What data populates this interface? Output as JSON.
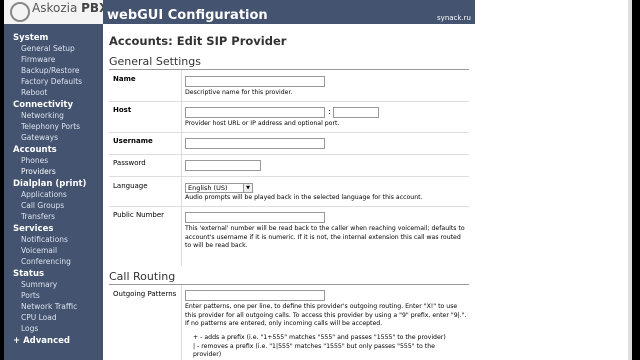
{
  "app": {
    "logo_text": "Askozia",
    "logo_suffix": "PBX",
    "title": "webGUI Configuration",
    "host": "synack.ru"
  },
  "sidebar": {
    "system": {
      "label": "System",
      "items": [
        "General Setup",
        "Firmware",
        "Backup/Restore",
        "Factory Defaults",
        "Reboot"
      ]
    },
    "connectivity": {
      "label": "Connectivity",
      "items": [
        "Networking",
        "Telephony Ports",
        "Gateways"
      ]
    },
    "accounts": {
      "label": "Accounts",
      "items": [
        "Phones",
        "Providers"
      ]
    },
    "dialplan": {
      "label": "Dialplan (print)",
      "items": [
        "Applications",
        "Call Groups",
        "Transfers"
      ]
    },
    "services": {
      "label": "Services",
      "items": [
        "Notifications",
        "Voicemail",
        "Conferencing"
      ]
    },
    "status": {
      "label": "Status",
      "items": [
        "Summary",
        "Ports",
        "Network Traffic",
        "CPU Load",
        "Logs"
      ]
    },
    "advanced": {
      "label": "+ Advanced"
    }
  },
  "page": {
    "title": "Accounts: Edit SIP Provider",
    "general_settings": "General Settings",
    "call_routing": "Call Routing"
  },
  "fields": {
    "name": {
      "label": "Name",
      "value": "",
      "help": "Descriptive name for this provider."
    },
    "host": {
      "label": "Host",
      "value": "",
      "port": "",
      "colon": ":",
      "help": "Provider host URL or IP address and optional port."
    },
    "username": {
      "label": "Username",
      "value": ""
    },
    "password": {
      "label": "Password",
      "value": ""
    },
    "language": {
      "label": "Language",
      "selected": "English (US)",
      "help": "Audio prompts will be played back in the selected language for this account."
    },
    "public_number": {
      "label": "Public Number",
      "value": "",
      "help": "This 'external' number will be read back to the caller when reaching voicemail; defaults to account's username if it is numeric. If it is not, the internal extension this call was routed to will be read back."
    },
    "outgoing_patterns": {
      "label": "Outgoing Patterns",
      "help": "Enter patterns, one per line, to define this provider's outgoing routing. Enter \"X!\" to use this provider for all outgoing calls. To access this provider by using a \"9\" prefix, enter \"9|.\". If no patterns are entered, only incoming calls will be accepted.",
      "bullet1": "+ - adds a prefix (i.e. \"1+555\" matches \"555\" and passes \"1555\" to the provider)",
      "bullet2": "| - removes a prefix (i.e. \"1|555\" matches \"1555\" but only passes \"555\" to the provider)"
    }
  }
}
